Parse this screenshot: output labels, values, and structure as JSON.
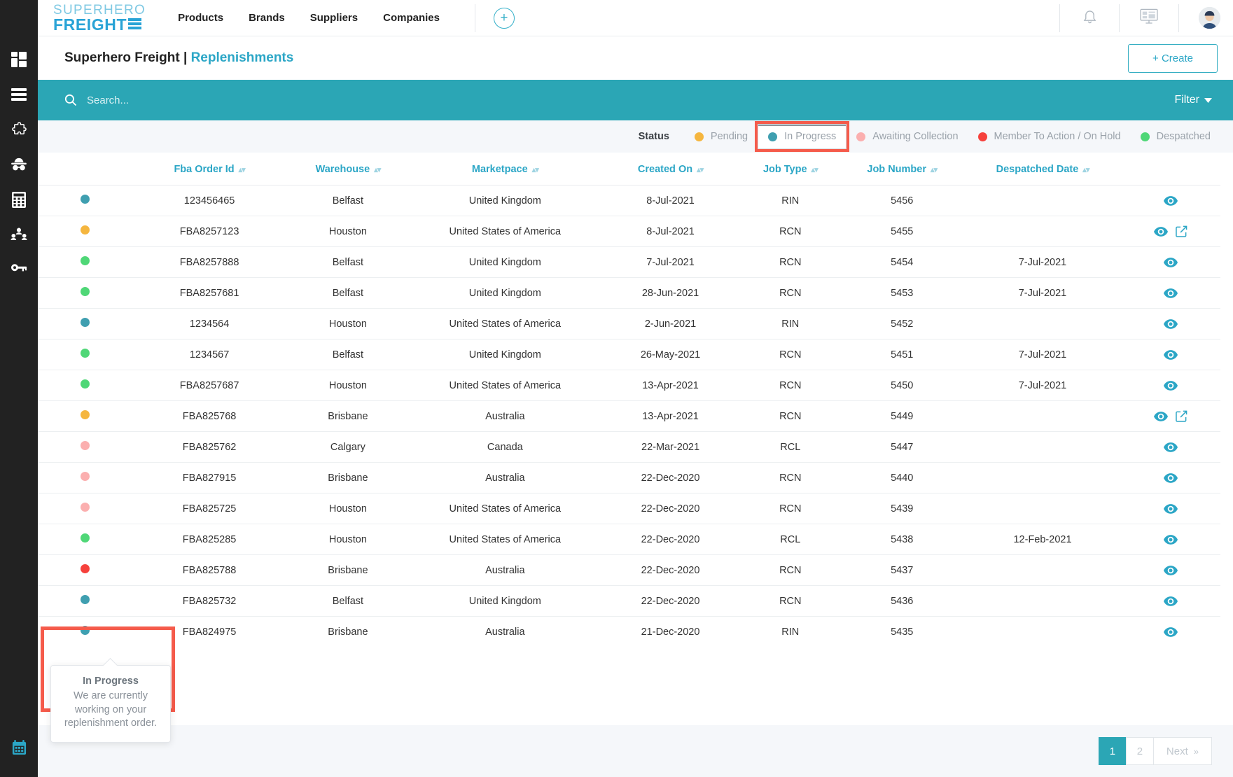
{
  "sidebar": {
    "items": [
      {
        "icon": "dashboard-grid-icon",
        "name": "sidebar-item-dashboard"
      },
      {
        "icon": "list-menu-icon",
        "name": "sidebar-item-list"
      },
      {
        "icon": "puzzle-icon",
        "name": "sidebar-item-integrations"
      },
      {
        "icon": "incognito-hat-icon",
        "name": "sidebar-item-incognito"
      },
      {
        "icon": "calculator-icon",
        "name": "sidebar-item-calculator"
      },
      {
        "icon": "users-sync-icon",
        "name": "sidebar-item-users"
      },
      {
        "icon": "key-icon",
        "name": "sidebar-item-keys"
      }
    ],
    "bottom_item": {
      "icon": "calendar-icon",
      "name": "sidebar-item-calendar",
      "color": "#2ba6c6"
    }
  },
  "topnav": {
    "logo_line1": "SUPERHERO",
    "logo_line2": "FREIGHT",
    "links": [
      "Products",
      "Brands",
      "Suppliers",
      "Companies"
    ],
    "add_button_label": "+",
    "icons": [
      "bell-icon",
      "monitor-dashboard-icon",
      "avatar"
    ]
  },
  "header": {
    "title_main": "Superhero Freight",
    "title_sep": " | ",
    "title_accent": "Replenishments",
    "create_label": "+ Create"
  },
  "search": {
    "placeholder": "Search...",
    "value": "",
    "filter_label": "Filter"
  },
  "legend": {
    "label": "Status",
    "items": [
      {
        "label": "Pending",
        "color": "#f5b63f",
        "selected": false
      },
      {
        "label": "In Progress",
        "color": "#3f9fb0",
        "selected": true
      },
      {
        "label": "Awaiting Collection",
        "color": "#fbafaf",
        "selected": false
      },
      {
        "label": "Member To Action / On Hold",
        "color": "#f6413c",
        "selected": false
      },
      {
        "label": "Despatched",
        "color": "#4fd777",
        "selected": false
      }
    ]
  },
  "table": {
    "columns": [
      {
        "label": "",
        "key": "status"
      },
      {
        "label": "Fba Order Id",
        "key": "fba"
      },
      {
        "label": "Warehouse",
        "key": "warehouse"
      },
      {
        "label": "Marketpace",
        "key": "marketplace"
      },
      {
        "label": "Created On",
        "key": "created"
      },
      {
        "label": "Job Type",
        "key": "jobtype"
      },
      {
        "label": "Job Number",
        "key": "jobnumber"
      },
      {
        "label": "Despatched Date",
        "key": "despatched"
      },
      {
        "label": "",
        "key": "actions"
      }
    ],
    "rows": [
      {
        "status": "#3f9fb0",
        "fba": "123456465",
        "warehouse": "Belfast",
        "marketplace": "United Kingdom",
        "created": "8-Jul-2021",
        "jobtype": "RIN",
        "jobnumber": "5456",
        "despatched": "",
        "actions": [
          "eye-icon"
        ]
      },
      {
        "status": "#f5b63f",
        "fba": "FBA8257123",
        "warehouse": "Houston",
        "marketplace": "United States of America",
        "created": "8-Jul-2021",
        "jobtype": "RCN",
        "jobnumber": "5455",
        "despatched": "",
        "actions": [
          "eye-icon",
          "edit-icon"
        ]
      },
      {
        "status": "#4fd777",
        "fba": "FBA8257888",
        "warehouse": "Belfast",
        "marketplace": "United Kingdom",
        "created": "7-Jul-2021",
        "jobtype": "RCN",
        "jobnumber": "5454",
        "despatched": "7-Jul-2021",
        "actions": [
          "eye-icon"
        ]
      },
      {
        "status": "#4fd777",
        "fba": "FBA8257681",
        "warehouse": "Belfast",
        "marketplace": "United Kingdom",
        "created": "28-Jun-2021",
        "jobtype": "RCN",
        "jobnumber": "5453",
        "despatched": "7-Jul-2021",
        "actions": [
          "eye-icon"
        ]
      },
      {
        "status": "#3f9fb0",
        "fba": "1234564",
        "warehouse": "Houston",
        "marketplace": "United States of America",
        "created": "2-Jun-2021",
        "jobtype": "RIN",
        "jobnumber": "5452",
        "despatched": "",
        "actions": [
          "eye-icon"
        ]
      },
      {
        "status": "#4fd777",
        "fba": "1234567",
        "warehouse": "Belfast",
        "marketplace": "United Kingdom",
        "created": "26-May-2021",
        "jobtype": "RCN",
        "jobnumber": "5451",
        "despatched": "7-Jul-2021",
        "actions": [
          "eye-icon"
        ]
      },
      {
        "status": "#4fd777",
        "fba": "FBA8257687",
        "warehouse": "Houston",
        "marketplace": "United States of America",
        "created": "13-Apr-2021",
        "jobtype": "RCN",
        "jobnumber": "5450",
        "despatched": "7-Jul-2021",
        "actions": [
          "eye-icon"
        ]
      },
      {
        "status": "#f5b63f",
        "fba": "FBA825768",
        "warehouse": "Brisbane",
        "marketplace": "Australia",
        "created": "13-Apr-2021",
        "jobtype": "RCN",
        "jobnumber": "5449",
        "despatched": "",
        "actions": [
          "eye-icon",
          "edit-icon"
        ]
      },
      {
        "status": "#fbafaf",
        "fba": "FBA825762",
        "warehouse": "Calgary",
        "marketplace": "Canada",
        "created": "22-Mar-2021",
        "jobtype": "RCL",
        "jobnumber": "5447",
        "despatched": "",
        "actions": [
          "eye-icon"
        ]
      },
      {
        "status": "#fbafaf",
        "fba": "FBA827915",
        "warehouse": "Brisbane",
        "marketplace": "Australia",
        "created": "22-Dec-2020",
        "jobtype": "RCN",
        "jobnumber": "5440",
        "despatched": "",
        "actions": [
          "eye-icon"
        ]
      },
      {
        "status": "#fbafaf",
        "fba": "FBA825725",
        "warehouse": "Houston",
        "marketplace": "United States of America",
        "created": "22-Dec-2020",
        "jobtype": "RCN",
        "jobnumber": "5439",
        "despatched": "",
        "actions": [
          "eye-icon"
        ]
      },
      {
        "status": "#4fd777",
        "fba": "FBA825285",
        "warehouse": "Houston",
        "marketplace": "United States of America",
        "created": "22-Dec-2020",
        "jobtype": "RCL",
        "jobnumber": "5438",
        "despatched": "12-Feb-2021",
        "actions": [
          "eye-icon"
        ]
      },
      {
        "status": "#f6413c",
        "fba": "FBA825788",
        "warehouse": "Brisbane",
        "marketplace": "Australia",
        "created": "22-Dec-2020",
        "jobtype": "RCN",
        "jobnumber": "5437",
        "despatched": "",
        "actions": [
          "eye-icon"
        ]
      },
      {
        "status": "#3f9fb0",
        "fba": "FBA825732",
        "warehouse": "Belfast",
        "marketplace": "United Kingdom",
        "created": "22-Dec-2020",
        "jobtype": "RCN",
        "jobnumber": "5436",
        "despatched": "",
        "actions": [
          "eye-icon"
        ]
      },
      {
        "status": "#3f9fb0",
        "fba": "FBA824975",
        "warehouse": "Brisbane",
        "marketplace": "Australia",
        "created": "21-Dec-2020",
        "jobtype": "RIN",
        "jobnumber": "5435",
        "despatched": "",
        "actions": [
          "eye-icon"
        ]
      }
    ]
  },
  "pagination": {
    "pages": [
      "1",
      "2"
    ],
    "active": "1",
    "next_label": "Next",
    "next_chevron": "»"
  },
  "tooltip": {
    "title": "In Progress",
    "body": "We are currently working on your replenishment order."
  },
  "colors": {
    "teal": "#2ba6b5",
    "brand_blue": "#29a3d6",
    "highlight_red": "#f55b4b",
    "sidebar_bg": "#222222"
  }
}
